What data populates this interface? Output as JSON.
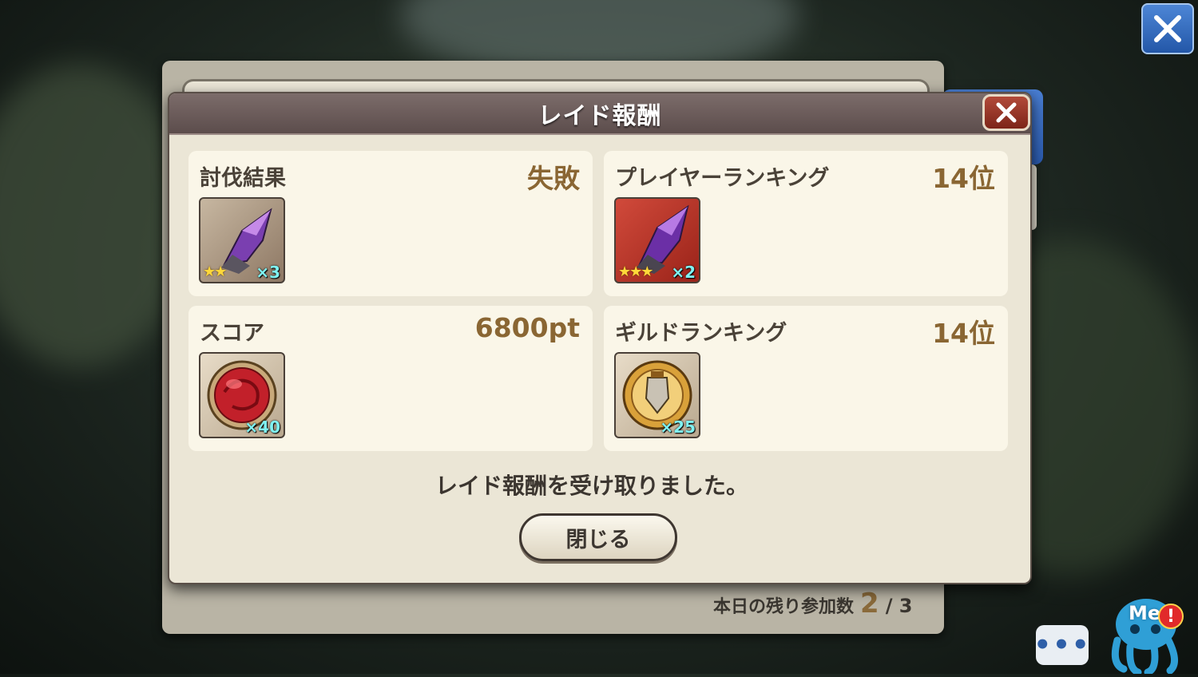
{
  "dialog": {
    "title": "レイド報酬",
    "message": "レイド報酬を受け取りました。",
    "close_label": "閉じる"
  },
  "panels": [
    {
      "title": "討伐結果",
      "value": "失敗",
      "item": {
        "icon": "purple-crystal-icon",
        "stars": "★★",
        "count": "×3"
      }
    },
    {
      "title": "プレイヤーランキング",
      "value": "14位",
      "item": {
        "icon": "purple-crystal-icon",
        "stars": "★★★",
        "count": "×2"
      }
    },
    {
      "title": "スコア",
      "value": "6800pt",
      "item": {
        "icon": "red-orb-icon",
        "stars": "",
        "count": "×40"
      }
    },
    {
      "title": "ギルドランキング",
      "value": "14位",
      "item": {
        "icon": "guild-medal-icon",
        "stars": "",
        "count": "×25"
      }
    }
  ],
  "footer": {
    "remaining_label": "本日の残り参加数",
    "remaining_value": "2",
    "remaining_total": "/ 3"
  },
  "corner": {
    "mascot_label": "Me",
    "alert_mark": "!",
    "chat_dots": "•••"
  },
  "colors": {
    "header": "#6b5c5a",
    "accent_value": "#8a6633",
    "count_text": "#7ff2f2",
    "blue_button": "#2e66bd"
  }
}
